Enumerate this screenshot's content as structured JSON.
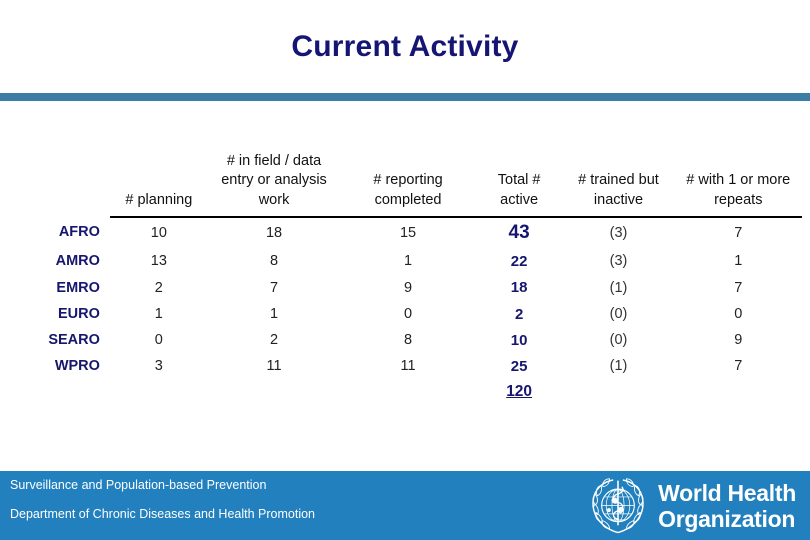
{
  "slide": {
    "title": "Current Activity",
    "accent_bar_color": "#3b7ea5",
    "title_color": "#151574",
    "footer_band_color": "#2180bd"
  },
  "table": {
    "corner_header": "",
    "columns": [
      "# planning",
      "# in field / data entry or analysis work",
      "# reporting completed",
      "Total # active",
      "# trained but inactive",
      "# with 1 or more repeats"
    ],
    "rows": [
      {
        "label": "AFRO",
        "planning": "10",
        "field_entry": "18",
        "reporting": "15",
        "total_active": "43",
        "trained_inactive": "(3)",
        "repeats": "7"
      },
      {
        "label": "AMRO",
        "planning": "13",
        "field_entry": "8",
        "reporting": "1",
        "total_active": "22",
        "trained_inactive": "(3)",
        "repeats": "1"
      },
      {
        "label": "EMRO",
        "planning": "2",
        "field_entry": "7",
        "reporting": "9",
        "total_active": "18",
        "trained_inactive": "(1)",
        "repeats": "7"
      },
      {
        "label": "EURO",
        "planning": "1",
        "field_entry": "1",
        "reporting": "0",
        "total_active": "2",
        "trained_inactive": "(0)",
        "repeats": "0"
      },
      {
        "label": "SEARO",
        "planning": "0",
        "field_entry": "2",
        "reporting": "8",
        "total_active": "10",
        "trained_inactive": "(0)",
        "repeats": "9"
      },
      {
        "label": "WPRO",
        "planning": "3",
        "field_entry": "11",
        "reporting": "11",
        "total_active": "25",
        "trained_inactive": "(1)",
        "repeats": "7"
      }
    ],
    "grand_total_active": "120"
  },
  "footer": {
    "line1": "Surveillance and Population-based Prevention",
    "line2": "Department of Chronic Diseases and Health Promotion",
    "logo": {
      "name_line1": "World Health",
      "name_line2": "Organization",
      "emblem": "who-emblem-icon"
    }
  }
}
